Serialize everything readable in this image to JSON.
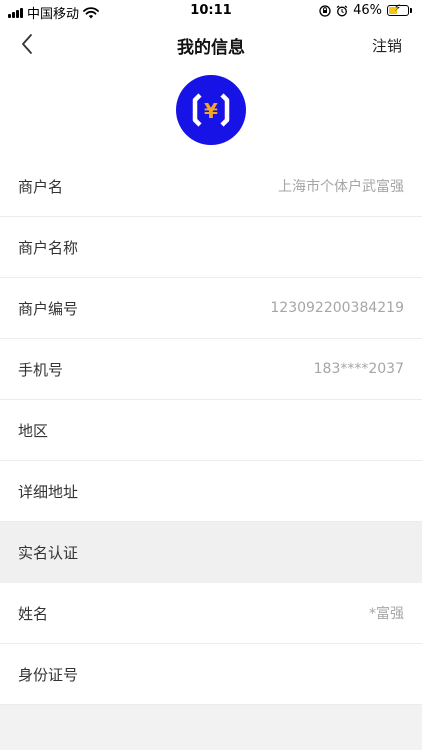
{
  "status": {
    "carrier": "中国移动",
    "time": "10:11",
    "battery": "46%",
    "battery_level": 0.46
  },
  "nav": {
    "title": "我的信息",
    "right_action": "注销"
  },
  "avatar": {
    "glyph": "¥"
  },
  "rows": [
    {
      "label": "商户名",
      "value": "上海市个体户武富强"
    },
    {
      "label": "商户名称",
      "value": ""
    },
    {
      "label": "商户编号",
      "value": "123092200384219"
    },
    {
      "label": "手机号",
      "value": "183****2037"
    },
    {
      "label": "地区",
      "value": ""
    },
    {
      "label": "详细地址",
      "value": ""
    }
  ],
  "section": {
    "label": "实名认证"
  },
  "rows2": [
    {
      "label": "姓名",
      "value": "*富强"
    },
    {
      "label": "身份证号",
      "value": ""
    }
  ],
  "colors": {
    "avatar_bg": "#1712e6",
    "avatar_yen": "#f5a623"
  }
}
